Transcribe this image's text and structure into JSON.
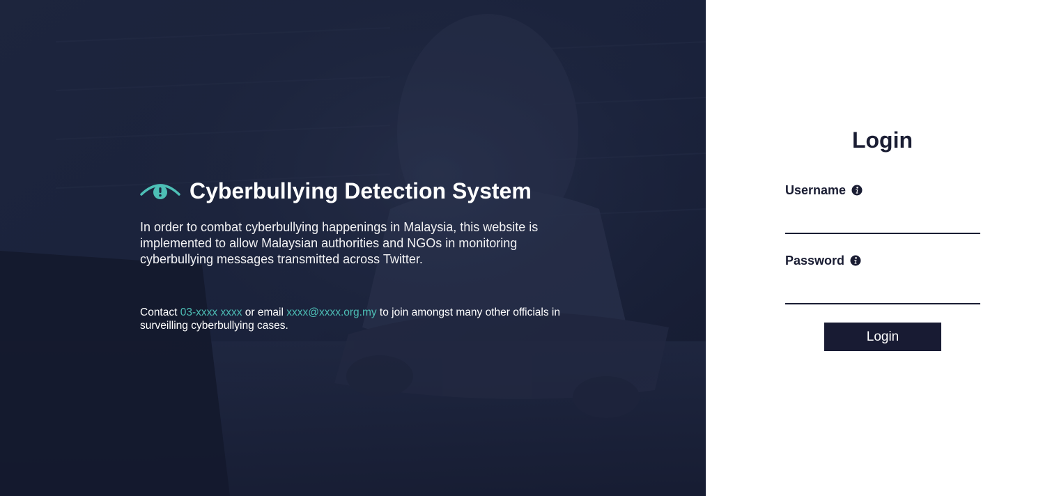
{
  "colors": {
    "accent": "#4dbfb6",
    "navy": "#181b33",
    "text_dark": "#1a1d33"
  },
  "hero": {
    "brand_icon": "eye-icon",
    "title": "Cyberbullying Detection System",
    "description": "In order to combat cyberbullying happenings in Malaysia, this website is implemented to allow Malaysian authorities and NGOs in monitoring cyberbullying messages transmitted across Twitter.",
    "contact": {
      "prefix": "Contact ",
      "phone": "03-xxxx xxxx",
      "middle": " or email ",
      "email": "xxxx@xxxx.org.my",
      "suffix": " to join amongst many other officials in surveilling cyberbullying cases."
    }
  },
  "login": {
    "title": "Login",
    "username": {
      "label": "Username",
      "value": "",
      "icon": "info-icon"
    },
    "password": {
      "label": "Password",
      "value": "",
      "icon": "info-icon"
    },
    "button_label": "Login"
  }
}
